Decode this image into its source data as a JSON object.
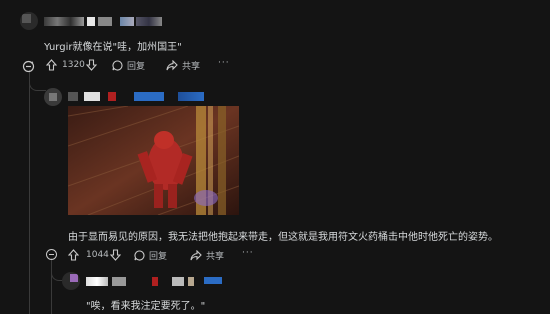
{
  "comments": [
    {
      "body": "Yurgir就像在说\"哇，加州国王\"",
      "score": "1320",
      "reply_label": "回复",
      "share_label": "共享",
      "more_label": "···"
    },
    {
      "body": "由于显而易见的原因，我无法把他抱起来带走，但这就是我用符文火药桶击中他时他死亡的姿势。",
      "score": "1044",
      "reply_label": "回复",
      "share_label": "共享",
      "more_label": "···"
    },
    {
      "body": "\"唉，看来我注定要死了。\""
    }
  ],
  "colors": {
    "background": "#141414",
    "text": "#d7dadc",
    "muted": "#b8bcbf",
    "thread_line": "#3a3a3a",
    "redacted_blue": "#2b6cc4",
    "redacted_red": "#b02020"
  },
  "icons": [
    "collapse-icon",
    "upvote-arrow-icon",
    "downvote-arrow-icon",
    "reply-bubble-icon",
    "share-arrow-icon",
    "more-dots-icon",
    "avatar-icon"
  ]
}
